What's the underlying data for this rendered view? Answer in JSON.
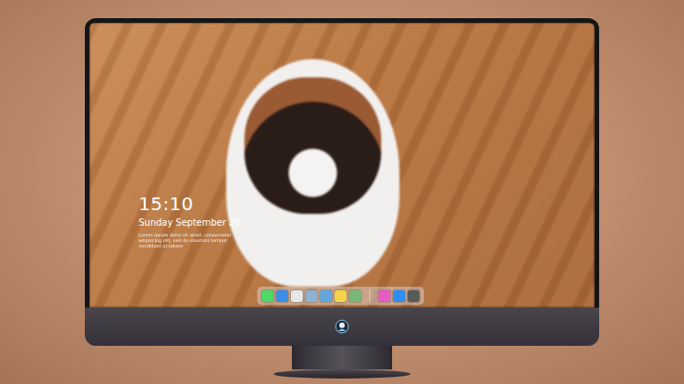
{
  "lockscreen": {
    "time": "15:10",
    "date": "Sunday September 28",
    "caption": "Lorem ipsum dolor sit amet, consectetur adipiscing elit, sed do eiusmod tempor incididunt ut labore"
  },
  "dock": {
    "apps": [
      {
        "kind": "app",
        "color": "#4cd964"
      },
      {
        "kind": "app",
        "color": "#3a8ee6"
      },
      {
        "kind": "app",
        "color": "#e6e6e6"
      },
      {
        "kind": "app",
        "color": "#8fb3cf"
      },
      {
        "kind": "app",
        "color": "#5fa8dc"
      },
      {
        "kind": "app",
        "color": "#f5d547"
      },
      {
        "kind": "app",
        "color": "#78b878"
      },
      {
        "kind": "separator",
        "color": "#d0d0d0"
      },
      {
        "kind": "app",
        "color": "#e45cc4"
      },
      {
        "kind": "app",
        "color": "#2f8ff0"
      },
      {
        "kind": "app",
        "color": "#5a5a5a"
      }
    ]
  }
}
